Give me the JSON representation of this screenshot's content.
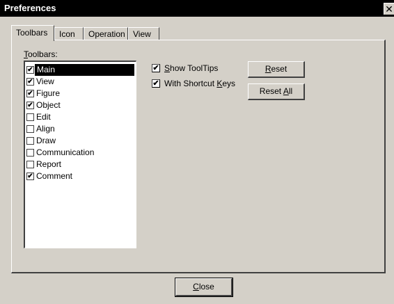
{
  "window": {
    "title": "Preferences",
    "close_glyph": "✕"
  },
  "tabs": [
    {
      "label": "Toolbars",
      "active": true
    },
    {
      "label": "Icon",
      "active": false
    },
    {
      "label": "Operation",
      "active": false
    },
    {
      "label": "View",
      "active": false
    }
  ],
  "toolbars": {
    "label_mnemonic": "T",
    "label_rest": "oolbars:",
    "items": [
      {
        "label": "Main",
        "checked": true,
        "selected": true
      },
      {
        "label": "View",
        "checked": true,
        "selected": false
      },
      {
        "label": "Figure",
        "checked": true,
        "selected": false
      },
      {
        "label": "Object",
        "checked": true,
        "selected": false
      },
      {
        "label": "Edit",
        "checked": false,
        "selected": false
      },
      {
        "label": "Align",
        "checked": false,
        "selected": false
      },
      {
        "label": "Draw",
        "checked": false,
        "selected": false
      },
      {
        "label": "Communication",
        "checked": false,
        "selected": false
      },
      {
        "label": "Report",
        "checked": false,
        "selected": false
      },
      {
        "label": "Comment",
        "checked": true,
        "selected": false
      }
    ]
  },
  "options": {
    "show_tooltips": {
      "mnemonic": "S",
      "rest": "how ToolTips",
      "checked": true
    },
    "shortcut_keys": {
      "prefix": "With Shortcut ",
      "mnemonic": "K",
      "rest": "eys",
      "checked": true
    }
  },
  "buttons": {
    "reset": {
      "mnemonic": "R",
      "rest": "eset"
    },
    "reset_all": {
      "prefix": "Reset ",
      "mnemonic": "A",
      "rest": "ll"
    },
    "close": {
      "mnemonic": "C",
      "rest": "lose"
    }
  },
  "check_glyph": "✔"
}
